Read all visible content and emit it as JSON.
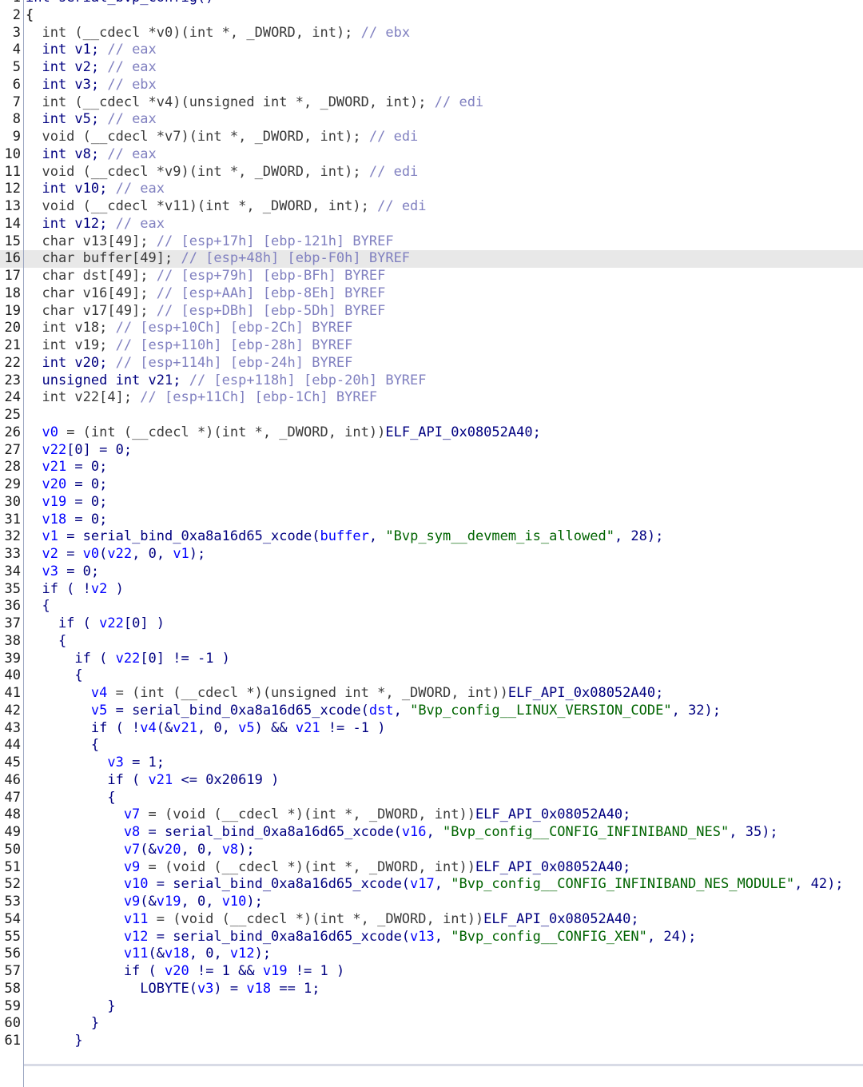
{
  "code_lines": [
    {
      "n": "1",
      "tokens": [
        {
          "t": "int serial_bvp_config()",
          "c": "k"
        }
      ]
    },
    {
      "n": "2",
      "tokens": [
        {
          "t": "{",
          "c": "p"
        }
      ]
    },
    {
      "n": "3",
      "tokens": [
        {
          "t": "  int (",
          "c": "g"
        },
        {
          "t": "__cdecl",
          "c": "g"
        },
        {
          "t": " *v0)(int *, _DWORD, int); ",
          "c": "g"
        },
        {
          "t": "// ebx",
          "c": "c"
        }
      ]
    },
    {
      "n": "4",
      "tokens": [
        {
          "t": "  int v1; ",
          "c": "k"
        },
        {
          "t": "// eax",
          "c": "c"
        }
      ]
    },
    {
      "n": "5",
      "tokens": [
        {
          "t": "  int v2; ",
          "c": "k"
        },
        {
          "t": "// eax",
          "c": "c"
        }
      ]
    },
    {
      "n": "6",
      "tokens": [
        {
          "t": "  int v3; ",
          "c": "k"
        },
        {
          "t": "// ebx",
          "c": "c"
        }
      ]
    },
    {
      "n": "7",
      "tokens": [
        {
          "t": "  int (__cdecl *v4)(unsigned int *, _DWORD, int); ",
          "c": "g"
        },
        {
          "t": "// edi",
          "c": "c"
        }
      ]
    },
    {
      "n": "8",
      "tokens": [
        {
          "t": "  int v5; ",
          "c": "k"
        },
        {
          "t": "// eax",
          "c": "c"
        }
      ]
    },
    {
      "n": "9",
      "tokens": [
        {
          "t": "  void (__cdecl *v7)(int *, _DWORD, int); ",
          "c": "g"
        },
        {
          "t": "// edi",
          "c": "c"
        }
      ]
    },
    {
      "n": "10",
      "tokens": [
        {
          "t": "  int v8; ",
          "c": "k"
        },
        {
          "t": "// eax",
          "c": "c"
        }
      ]
    },
    {
      "n": "11",
      "tokens": [
        {
          "t": "  void (__cdecl *v9)(int *, _DWORD, int); ",
          "c": "g"
        },
        {
          "t": "// edi",
          "c": "c"
        }
      ]
    },
    {
      "n": "12",
      "tokens": [
        {
          "t": "  int v10; ",
          "c": "k"
        },
        {
          "t": "// eax",
          "c": "c"
        }
      ]
    },
    {
      "n": "13",
      "tokens": [
        {
          "t": "  void (__cdecl *v11)(int *, _DWORD, int); ",
          "c": "g"
        },
        {
          "t": "// edi",
          "c": "c"
        }
      ]
    },
    {
      "n": "14",
      "tokens": [
        {
          "t": "  int v12; ",
          "c": "k"
        },
        {
          "t": "// eax",
          "c": "c"
        }
      ]
    },
    {
      "n": "15",
      "tokens": [
        {
          "t": "  char v13[49]; ",
          "c": "g"
        },
        {
          "t": "// [esp+17h] [ebp-121h] BYREF",
          "c": "c"
        }
      ]
    },
    {
      "n": "16",
      "tokens": [
        {
          "t": "  char buffer[49]; ",
          "c": "g"
        },
        {
          "t": "// [esp+48h] [ebp-F0h] BYREF",
          "c": "c"
        }
      ],
      "highlight": true
    },
    {
      "n": "17",
      "tokens": [
        {
          "t": "  char dst[49]; ",
          "c": "g"
        },
        {
          "t": "// [esp+79h] [ebp-BFh] BYREF",
          "c": "c"
        }
      ]
    },
    {
      "n": "18",
      "tokens": [
        {
          "t": "  char v16[49]; ",
          "c": "g"
        },
        {
          "t": "// [esp+AAh] [ebp-8Eh] BYREF",
          "c": "c"
        }
      ]
    },
    {
      "n": "19",
      "tokens": [
        {
          "t": "  char v17[49]; ",
          "c": "g"
        },
        {
          "t": "// [esp+DBh] [ebp-5Dh] BYREF",
          "c": "c"
        }
      ]
    },
    {
      "n": "20",
      "tokens": [
        {
          "t": "  int v18; ",
          "c": "g"
        },
        {
          "t": "// [esp+10Ch] [ebp-2Ch] BYREF",
          "c": "c"
        }
      ]
    },
    {
      "n": "21",
      "tokens": [
        {
          "t": "  int v19; ",
          "c": "g"
        },
        {
          "t": "// [esp+110h] [ebp-28h] BYREF",
          "c": "c"
        }
      ]
    },
    {
      "n": "22",
      "tokens": [
        {
          "t": "  int v20; ",
          "c": "k"
        },
        {
          "t": "// [esp+114h] [ebp-24h] BYREF",
          "c": "c"
        }
      ]
    },
    {
      "n": "23",
      "tokens": [
        {
          "t": "  unsigned int v21; ",
          "c": "k"
        },
        {
          "t": "// [esp+118h] [ebp-20h] BYREF",
          "c": "c"
        }
      ]
    },
    {
      "n": "24",
      "tokens": [
        {
          "t": "  int v22[4]; ",
          "c": "g"
        },
        {
          "t": "// [esp+11Ch] [ebp-1Ch] BYREF",
          "c": "c"
        }
      ]
    },
    {
      "n": "25",
      "tokens": [
        {
          "t": "",
          "c": "p"
        }
      ]
    },
    {
      "n": "26",
      "tokens": [
        {
          "t": "  v0",
          "c": "v"
        },
        {
          "t": " = (int (__cdecl *)(int *, _DWORD, int))",
          "c": "g"
        },
        {
          "t": "ELF_API_0x08052A40",
          "c": "k"
        },
        {
          "t": ";",
          "c": "k"
        }
      ]
    },
    {
      "n": "27",
      "tokens": [
        {
          "t": "  v22",
          "c": "v"
        },
        {
          "t": "[0] = 0;",
          "c": "k"
        }
      ]
    },
    {
      "n": "28",
      "tokens": [
        {
          "t": "  v21",
          "c": "v"
        },
        {
          "t": " = 0;",
          "c": "k"
        }
      ]
    },
    {
      "n": "29",
      "tokens": [
        {
          "t": "  v20",
          "c": "v"
        },
        {
          "t": " = 0;",
          "c": "k"
        }
      ]
    },
    {
      "n": "30",
      "tokens": [
        {
          "t": "  v19",
          "c": "v"
        },
        {
          "t": " = 0;",
          "c": "k"
        }
      ]
    },
    {
      "n": "31",
      "tokens": [
        {
          "t": "  v18",
          "c": "v"
        },
        {
          "t": " = 0;",
          "c": "k"
        }
      ]
    },
    {
      "n": "32",
      "tokens": [
        {
          "t": "  v1",
          "c": "v"
        },
        {
          "t": " = serial_bind_0xa8a16d65_xcode(",
          "c": "k"
        },
        {
          "t": "buffer",
          "c": "v"
        },
        {
          "t": ", ",
          "c": "k"
        },
        {
          "t": "\"Bvp_sym__devmem_is_allowed\"",
          "c": "s"
        },
        {
          "t": ", 28);",
          "c": "k"
        }
      ]
    },
    {
      "n": "33",
      "tokens": [
        {
          "t": "  v2",
          "c": "v"
        },
        {
          "t": " = ",
          "c": "k"
        },
        {
          "t": "v0",
          "c": "v"
        },
        {
          "t": "(",
          "c": "k"
        },
        {
          "t": "v22",
          "c": "v"
        },
        {
          "t": ", 0, ",
          "c": "k"
        },
        {
          "t": "v1",
          "c": "v"
        },
        {
          "t": ");",
          "c": "k"
        }
      ]
    },
    {
      "n": "34",
      "tokens": [
        {
          "t": "  v3",
          "c": "v"
        },
        {
          "t": " = 0;",
          "c": "k"
        }
      ]
    },
    {
      "n": "35",
      "tokens": [
        {
          "t": "  if ( !",
          "c": "k"
        },
        {
          "t": "v2",
          "c": "v"
        },
        {
          "t": " )",
          "c": "k"
        }
      ]
    },
    {
      "n": "36",
      "tokens": [
        {
          "t": "  {",
          "c": "k"
        }
      ]
    },
    {
      "n": "37",
      "tokens": [
        {
          "t": "    if ( ",
          "c": "k"
        },
        {
          "t": "v22",
          "c": "v"
        },
        {
          "t": "[0] )",
          "c": "k"
        }
      ]
    },
    {
      "n": "38",
      "tokens": [
        {
          "t": "    {",
          "c": "k"
        }
      ]
    },
    {
      "n": "39",
      "tokens": [
        {
          "t": "      if ( ",
          "c": "k"
        },
        {
          "t": "v22",
          "c": "v"
        },
        {
          "t": "[0] != -1 )",
          "c": "k"
        }
      ]
    },
    {
      "n": "40",
      "tokens": [
        {
          "t": "      {",
          "c": "k"
        }
      ]
    },
    {
      "n": "41",
      "tokens": [
        {
          "t": "        v4",
          "c": "v"
        },
        {
          "t": " = (int (__cdecl *)(unsigned int *, _DWORD, int))",
          "c": "g"
        },
        {
          "t": "ELF_API_0x08052A40;",
          "c": "k"
        }
      ]
    },
    {
      "n": "42",
      "tokens": [
        {
          "t": "        v5",
          "c": "v"
        },
        {
          "t": " = serial_bind_0xa8a16d65_xcode(",
          "c": "k"
        },
        {
          "t": "dst",
          "c": "v"
        },
        {
          "t": ", ",
          "c": "k"
        },
        {
          "t": "\"Bvp_config__LINUX_VERSION_CODE\"",
          "c": "s"
        },
        {
          "t": ", 32);",
          "c": "k"
        }
      ]
    },
    {
      "n": "43",
      "tokens": [
        {
          "t": "        if ( !",
          "c": "k"
        },
        {
          "t": "v4",
          "c": "v"
        },
        {
          "t": "(&",
          "c": "k"
        },
        {
          "t": "v21",
          "c": "v"
        },
        {
          "t": ", 0, ",
          "c": "k"
        },
        {
          "t": "v5",
          "c": "v"
        },
        {
          "t": ") && ",
          "c": "k"
        },
        {
          "t": "v21",
          "c": "v"
        },
        {
          "t": " != -1 )",
          "c": "k"
        }
      ]
    },
    {
      "n": "44",
      "tokens": [
        {
          "t": "        {",
          "c": "k"
        }
      ]
    },
    {
      "n": "45",
      "tokens": [
        {
          "t": "          v3",
          "c": "v"
        },
        {
          "t": " = 1;",
          "c": "k"
        }
      ]
    },
    {
      "n": "46",
      "tokens": [
        {
          "t": "          if ( ",
          "c": "k"
        },
        {
          "t": "v21",
          "c": "v"
        },
        {
          "t": " <= 0x20619 )",
          "c": "k"
        }
      ]
    },
    {
      "n": "47",
      "tokens": [
        {
          "t": "          {",
          "c": "k"
        }
      ]
    },
    {
      "n": "48",
      "tokens": [
        {
          "t": "            v7",
          "c": "v"
        },
        {
          "t": " = (void (__cdecl *)(int *, _DWORD, int))",
          "c": "g"
        },
        {
          "t": "ELF_API_0x08052A40;",
          "c": "k"
        }
      ]
    },
    {
      "n": "49",
      "tokens": [
        {
          "t": "            v8",
          "c": "v"
        },
        {
          "t": " = serial_bind_0xa8a16d65_xcode(",
          "c": "k"
        },
        {
          "t": "v16",
          "c": "v"
        },
        {
          "t": ", ",
          "c": "k"
        },
        {
          "t": "\"Bvp_config__CONFIG_INFINIBAND_NES\"",
          "c": "s"
        },
        {
          "t": ", 35);",
          "c": "k"
        }
      ]
    },
    {
      "n": "50",
      "tokens": [
        {
          "t": "            v7",
          "c": "v"
        },
        {
          "t": "(&",
          "c": "k"
        },
        {
          "t": "v20",
          "c": "v"
        },
        {
          "t": ", 0, ",
          "c": "k"
        },
        {
          "t": "v8",
          "c": "v"
        },
        {
          "t": ");",
          "c": "k"
        }
      ]
    },
    {
      "n": "51",
      "tokens": [
        {
          "t": "            v9",
          "c": "v"
        },
        {
          "t": " = (void (__cdecl *)(int *, _DWORD, int))",
          "c": "g"
        },
        {
          "t": "ELF_API_0x08052A40;",
          "c": "k"
        }
      ]
    },
    {
      "n": "52",
      "tokens": [
        {
          "t": "            v10",
          "c": "v"
        },
        {
          "t": " = serial_bind_0xa8a16d65_xcode(",
          "c": "k"
        },
        {
          "t": "v17",
          "c": "v"
        },
        {
          "t": ", ",
          "c": "k"
        },
        {
          "t": "\"Bvp_config__CONFIG_INFINIBAND_NES_MODULE\"",
          "c": "s"
        },
        {
          "t": ", 42);",
          "c": "k"
        }
      ]
    },
    {
      "n": "53",
      "tokens": [
        {
          "t": "            v9",
          "c": "v"
        },
        {
          "t": "(&",
          "c": "k"
        },
        {
          "t": "v19",
          "c": "v"
        },
        {
          "t": ", 0, ",
          "c": "k"
        },
        {
          "t": "v10",
          "c": "v"
        },
        {
          "t": ");",
          "c": "k"
        }
      ]
    },
    {
      "n": "54",
      "tokens": [
        {
          "t": "            v11",
          "c": "v"
        },
        {
          "t": " = (void (__cdecl *)(int *, _DWORD, int))",
          "c": "g"
        },
        {
          "t": "ELF_API_0x08052A40;",
          "c": "k"
        }
      ]
    },
    {
      "n": "55",
      "tokens": [
        {
          "t": "            v12",
          "c": "v"
        },
        {
          "t": " = serial_bind_0xa8a16d65_xcode(",
          "c": "k"
        },
        {
          "t": "v13",
          "c": "v"
        },
        {
          "t": ", ",
          "c": "k"
        },
        {
          "t": "\"Bvp_config__CONFIG_XEN\"",
          "c": "s"
        },
        {
          "t": ", 24);",
          "c": "k"
        }
      ]
    },
    {
      "n": "56",
      "tokens": [
        {
          "t": "            v11",
          "c": "v"
        },
        {
          "t": "(&",
          "c": "k"
        },
        {
          "t": "v18",
          "c": "v"
        },
        {
          "t": ", 0, ",
          "c": "k"
        },
        {
          "t": "v12",
          "c": "v"
        },
        {
          "t": ");",
          "c": "k"
        }
      ]
    },
    {
      "n": "57",
      "tokens": [
        {
          "t": "            if ( ",
          "c": "k"
        },
        {
          "t": "v20",
          "c": "v"
        },
        {
          "t": " != 1 && ",
          "c": "k"
        },
        {
          "t": "v19",
          "c": "v"
        },
        {
          "t": " != 1 )",
          "c": "k"
        }
      ]
    },
    {
      "n": "58",
      "tokens": [
        {
          "t": "              LOBYTE(",
          "c": "k"
        },
        {
          "t": "v3",
          "c": "v"
        },
        {
          "t": ") = ",
          "c": "k"
        },
        {
          "t": "v18",
          "c": "v"
        },
        {
          "t": " == 1;",
          "c": "k"
        }
      ]
    },
    {
      "n": "59",
      "tokens": [
        {
          "t": "          }",
          "c": "k"
        }
      ]
    },
    {
      "n": "60",
      "tokens": [
        {
          "t": "        }",
          "c": "k"
        }
      ]
    },
    {
      "n": "61",
      "tokens": [
        {
          "t": "      }",
          "c": "k"
        }
      ]
    }
  ],
  "colors": {
    "keyword": "#000080",
    "variable": "#0000ff",
    "comment": "#8080c0",
    "string": "#006400",
    "highlight_row": "#e8e8e8"
  }
}
